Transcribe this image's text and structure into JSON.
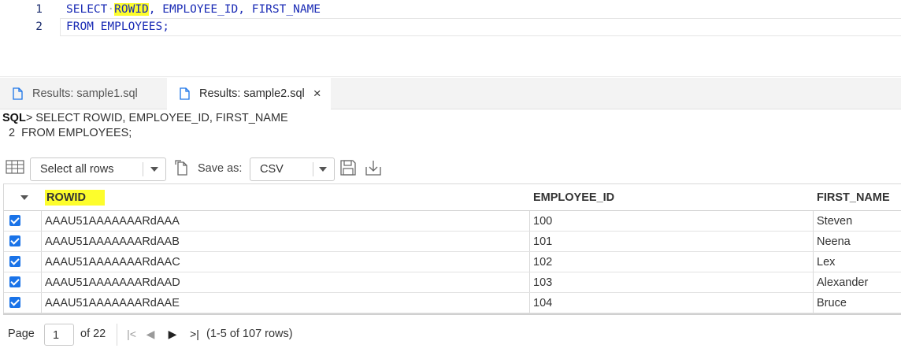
{
  "editor": {
    "lines": [
      {
        "num": "1",
        "kw_select": "SELECT",
        "col_rowid": "ROWID",
        "rest": ", EMPLOYEE_ID, FIRST_NAME"
      },
      {
        "num": "2",
        "text": "FROM EMPLOYEES;"
      }
    ]
  },
  "tabs": [
    {
      "label": "Results: sample1.sql",
      "icon": "file-icon",
      "active": false
    },
    {
      "label": "Results: sample2.sql",
      "icon": "file-icon",
      "active": true,
      "close": "×"
    }
  ],
  "output": {
    "prompt": "SQL",
    "line1": "> SELECT ROWID, EMPLOYEE_ID, FIRST_NAME",
    "line2": "2  FROM EMPLOYEES;"
  },
  "toolbar": {
    "grid_icon": "table-grid-icon",
    "rows_select": "Select all rows",
    "copy_icon": "copy-icon",
    "save_as_label": "Save as:",
    "format_select": "CSV",
    "save_icon": "save-icon",
    "download_icon": "download-icon"
  },
  "grid": {
    "columns": [
      "ROWID",
      "EMPLOYEE_ID",
      "FIRST_NAME"
    ],
    "rows": [
      {
        "checked": true,
        "rowid": "AAAU51AAAAAAARdAAA",
        "employee_id": "100",
        "first_name": "Steven"
      },
      {
        "checked": true,
        "rowid": "AAAU51AAAAAAARdAAB",
        "employee_id": "101",
        "first_name": "Neena"
      },
      {
        "checked": true,
        "rowid": "AAAU51AAAAAAARdAAC",
        "employee_id": "102",
        "first_name": "Lex"
      },
      {
        "checked": true,
        "rowid": "AAAU51AAAAAAARdAAD",
        "employee_id": "103",
        "first_name": "Alexander"
      },
      {
        "checked": true,
        "rowid": "AAAU51AAAAAAARdAAE",
        "employee_id": "104",
        "first_name": "Bruce"
      }
    ]
  },
  "pager": {
    "page_label": "Page",
    "page_value": "1",
    "of_label": "of 22",
    "first": "|<",
    "prev": "◀",
    "next": "▶",
    "last": ">|",
    "count": "(1-5 of 107 rows)"
  },
  "colors": {
    "highlight": "#fdfd2c",
    "keyword": "#1a2bb5",
    "checkbox": "#1a73e8"
  }
}
